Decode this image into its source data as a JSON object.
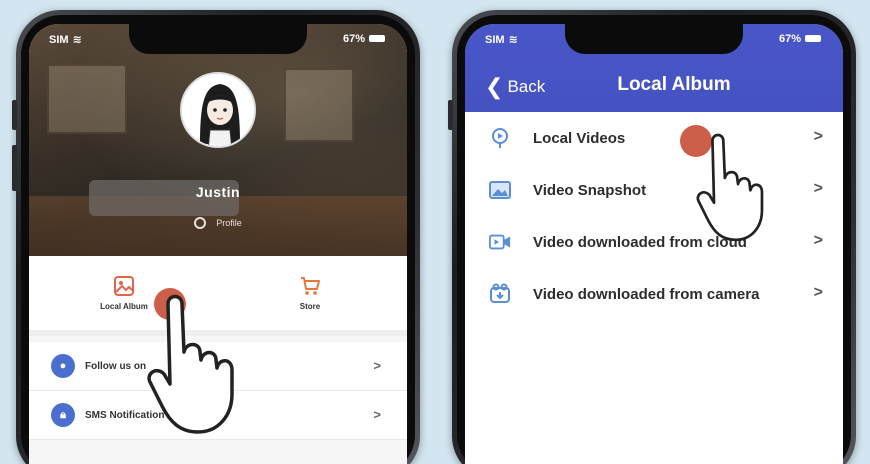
{
  "left_screen": {
    "status": {
      "carrier": "SIM",
      "battery": "67%"
    },
    "profile": {
      "name": "Justin",
      "profile_link": "Profile"
    },
    "quick_actions": [
      {
        "label": "Local Album",
        "icon": "image-icon",
        "color": "#e0654a"
      },
      {
        "label": "Store",
        "icon": "cart-icon",
        "color": "#e8763a"
      }
    ],
    "menu": [
      {
        "label": "Follow us on",
        "icon": "chat-icon",
        "chevron": ">"
      },
      {
        "label": "SMS Notification",
        "icon": "lock-icon",
        "chevron": ">"
      }
    ]
  },
  "right_screen": {
    "status": {
      "carrier": "SIM",
      "battery": "67%"
    },
    "nav": {
      "back_label": "Back",
      "title": "Local Album",
      "color": "#4956c8"
    },
    "items": [
      {
        "label": "Local Videos",
        "icon": "video-pin-icon",
        "chevron": ">"
      },
      {
        "label": "Video Snapshot",
        "icon": "picture-icon",
        "chevron": ">"
      },
      {
        "label": "Video downloaded from cloud",
        "icon": "video-camera-icon",
        "chevron": ">"
      },
      {
        "label": "Video downloaded from camera",
        "icon": "camera-download-icon",
        "chevron": ">"
      }
    ]
  },
  "colors": {
    "background": "#d3e5f0",
    "accent_blue": "#4a6fd0",
    "touch_dot": "#c9503a"
  }
}
